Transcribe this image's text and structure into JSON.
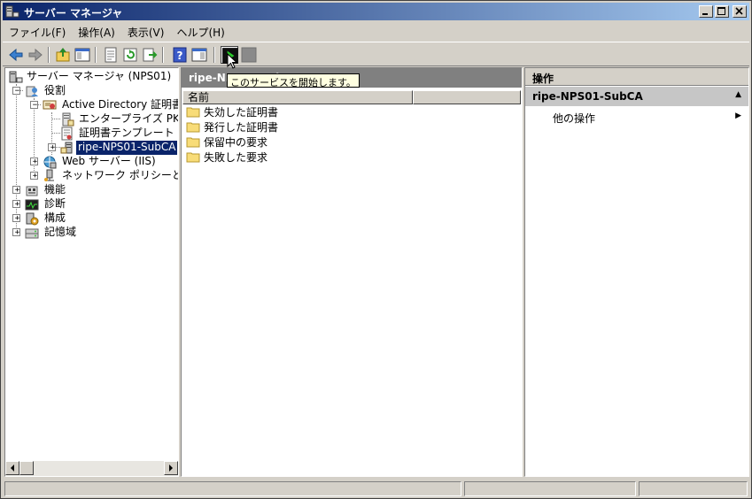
{
  "window": {
    "title": "サーバー マネージャ",
    "controls": [
      "minimize",
      "maximize",
      "close"
    ]
  },
  "menubar": {
    "items": [
      "ファイル(F)",
      "操作(A)",
      "表示(V)",
      "ヘルプ(H)"
    ]
  },
  "toolbar": {
    "tooltip": "このサービスを開始します。",
    "buttons": [
      "back-icon",
      "forward-icon",
      "up-folder-icon",
      "show-hide-tree-icon",
      "properties-icon",
      "refresh-icon",
      "export-icon",
      "help-icon",
      "show-hide-action-icon",
      "start-service-icon",
      "stop-service-icon"
    ]
  },
  "tree": {
    "root": "サーバー マネージャ (NPS01)",
    "roles": "役割",
    "adcs": "Active Directory 証明書サ",
    "enterprise_pki": "エンタープライズ PKI",
    "cert_templates": "証明書テンプレート",
    "selected_ca": "ripe-NPS01-SubCA",
    "web_server": "Web サーバー (IIS)",
    "nps": "ネットワーク ポリシーとアクセス",
    "features": "機能",
    "diagnostics": "診断",
    "configuration": "構成",
    "storage": "記憶域"
  },
  "middle": {
    "header": "ripe-NPS01-SubCA",
    "column_name": "名前",
    "items": [
      "失効した証明書",
      "発行した証明書",
      "保留中の要求",
      "失敗した要求"
    ]
  },
  "actions": {
    "header": "操作",
    "section": "ripe-NPS01-SubCA",
    "more_actions": "他の操作"
  },
  "colors": {
    "title_start": "#0a246a",
    "title_end": "#a6caf0",
    "selection": "#0a246a",
    "chrome": "#d4d0c8"
  }
}
